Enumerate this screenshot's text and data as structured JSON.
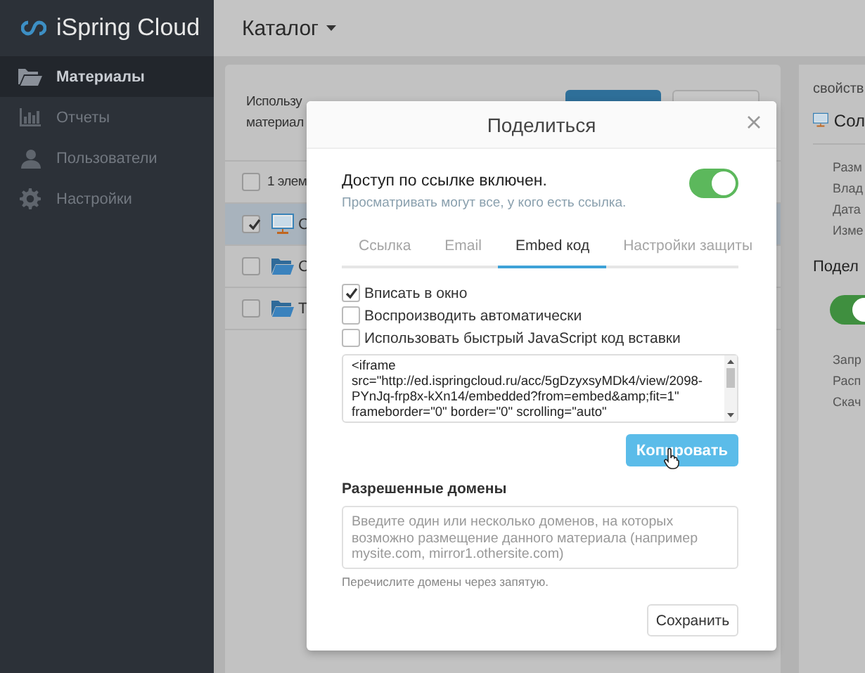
{
  "sidebar": {
    "logo": "iSpring Cloud",
    "items": [
      {
        "label": "Материалы",
        "selected": true
      },
      {
        "label": "Отчеты",
        "selected": false
      },
      {
        "label": "Пользователи",
        "selected": false
      },
      {
        "label": "Настройки",
        "selected": false
      }
    ]
  },
  "header": {
    "title": "Каталог"
  },
  "catalog": {
    "intro_lines": [
      "Использу",
      "материал"
    ],
    "select_all": {
      "checked": false,
      "label": "1 элем"
    },
    "rows": [
      {
        "kind": "presentation",
        "name": "С",
        "checked": true,
        "selected": true
      },
      {
        "kind": "folder",
        "name": "С",
        "checked": false,
        "selected": false
      },
      {
        "kind": "folder",
        "name": "Т",
        "checked": false,
        "selected": false
      }
    ]
  },
  "properties": {
    "title": "свойств",
    "file_name": "Сол",
    "fields": [
      "Разм",
      "Влад",
      "Дата",
      "Изме"
    ],
    "share_heading": "Подел",
    "share_on": true,
    "share_fields": [
      "Запр",
      "Расп",
      "Скач"
    ]
  },
  "dialog": {
    "title": "Поделиться",
    "access_title": "Доступ по ссылке включен.",
    "access_on": true,
    "access_note": "Просматривать могут все, у кого есть ссылка.",
    "tabs": [
      {
        "label": "Ссылка",
        "selected": false
      },
      {
        "label": "Email",
        "selected": false
      },
      {
        "label": "Embed код",
        "selected": true
      },
      {
        "label": "Настройки защиты",
        "selected": false
      }
    ],
    "options": [
      {
        "label": "Вписать в окно",
        "checked": true
      },
      {
        "label": "Воспроизводить автоматически",
        "checked": false
      },
      {
        "label": "Использовать быстрый JavaScript код вставки",
        "checked": false
      }
    ],
    "embed_code": "<iframe\nsrc=\"http://ed.ispringcloud.ru/acc/5gDzyxsyMDk4/view/2098-\nPYnJq-frp8x-kXn14/embedded?from=embed&amp;fit=1\"\nframeborder=\"0\" border=\"0\" scrolling=\"auto\"",
    "copy_button": "Копировать",
    "domains_label": "Разрешенные домены",
    "domains_placeholder": "Введите один или несколько доменов, на которых возможно размещение данного материала (например mysite.com, mirror1.othersite.com)",
    "domains_hint": "Перечислите домены через запятую.",
    "save_button": "Сохранить"
  }
}
